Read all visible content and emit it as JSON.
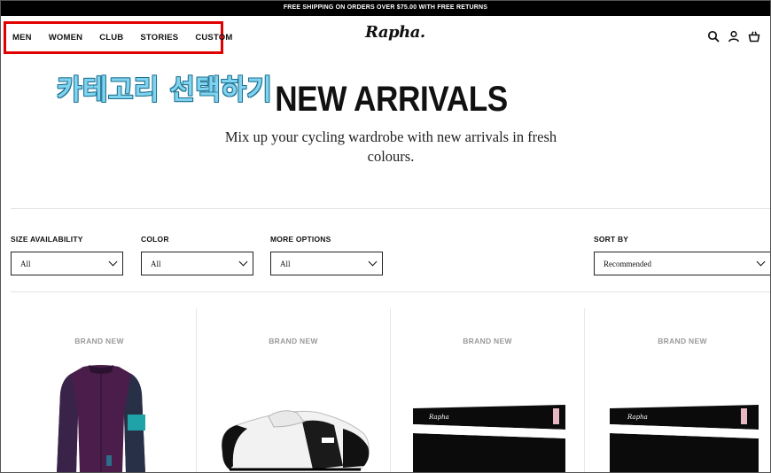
{
  "promo_bar": {
    "text": "FREE SHIPPING ON ORDERS OVER $75.00 WITH FREE RETURNS"
  },
  "nav": {
    "items": [
      {
        "label": "MEN"
      },
      {
        "label": "WOMEN"
      },
      {
        "label": "CLUB"
      },
      {
        "label": "STORIES"
      },
      {
        "label": "CUSTOM"
      }
    ],
    "highlight_color": "#e00000"
  },
  "brand": {
    "logo_text": "Rapha."
  },
  "header_icons": [
    "search-icon",
    "account-icon",
    "cart-icon"
  ],
  "annotation": {
    "text": "카테고리 선택하기",
    "color": "#7fd3ee"
  },
  "hero": {
    "title": "NEW ARRIVALS",
    "subtitle": "Mix up your cycling wardrobe with new arrivals in fresh colours."
  },
  "filters": [
    {
      "label": "SIZE AVAILABILITY",
      "value": "All"
    },
    {
      "label": "COLOR",
      "value": "All"
    },
    {
      "label": "MORE OPTIONS",
      "value": "All"
    },
    {
      "label": "SORT BY",
      "value": "Recommended"
    }
  ],
  "products": [
    {
      "badge": "BRAND NEW",
      "image": "purple-cycling-jersey"
    },
    {
      "badge": "BRAND NEW",
      "image": "white-black-cycling-shoe"
    },
    {
      "badge": "BRAND NEW",
      "image": "black-arm-warmers"
    },
    {
      "badge": "BRAND NEW",
      "image": "black-leg-warmers"
    }
  ]
}
